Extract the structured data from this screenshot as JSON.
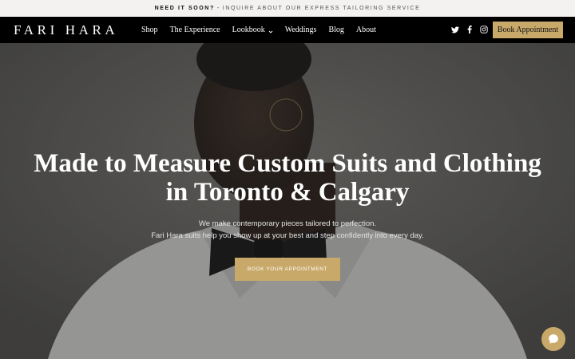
{
  "announcement": {
    "bold": "NEED IT SOON?",
    "separator": "-",
    "link": "INQUIRE ABOUT OUR EXPRESS TAILORING SERVICE"
  },
  "header": {
    "logo": "FARI HARA",
    "menu": [
      {
        "label": "Shop"
      },
      {
        "label": "The Experience"
      },
      {
        "label": "Lookbook"
      },
      {
        "label": "Weddings"
      },
      {
        "label": "Blog"
      },
      {
        "label": "About"
      }
    ],
    "social_icons": [
      "twitter-icon",
      "facebook-icon",
      "instagram-icon"
    ],
    "book_button": "Book Appointment"
  },
  "hero": {
    "title": "Made to Measure Custom Suits and Clothing in Toronto & Calgary",
    "subtitle_line1": "We make contemporary pieces tailored to perfection.",
    "subtitle_line2": "Fari Hara suits help you show up at your best and step confidently into every day.",
    "cta": "BOOK YOUR APPOINTMENT"
  },
  "colors": {
    "accent": "#c9a96a",
    "nav_bg": "#000000",
    "announce_bg": "#f3f2f0"
  },
  "chat_icon": "chat-bubble-icon"
}
